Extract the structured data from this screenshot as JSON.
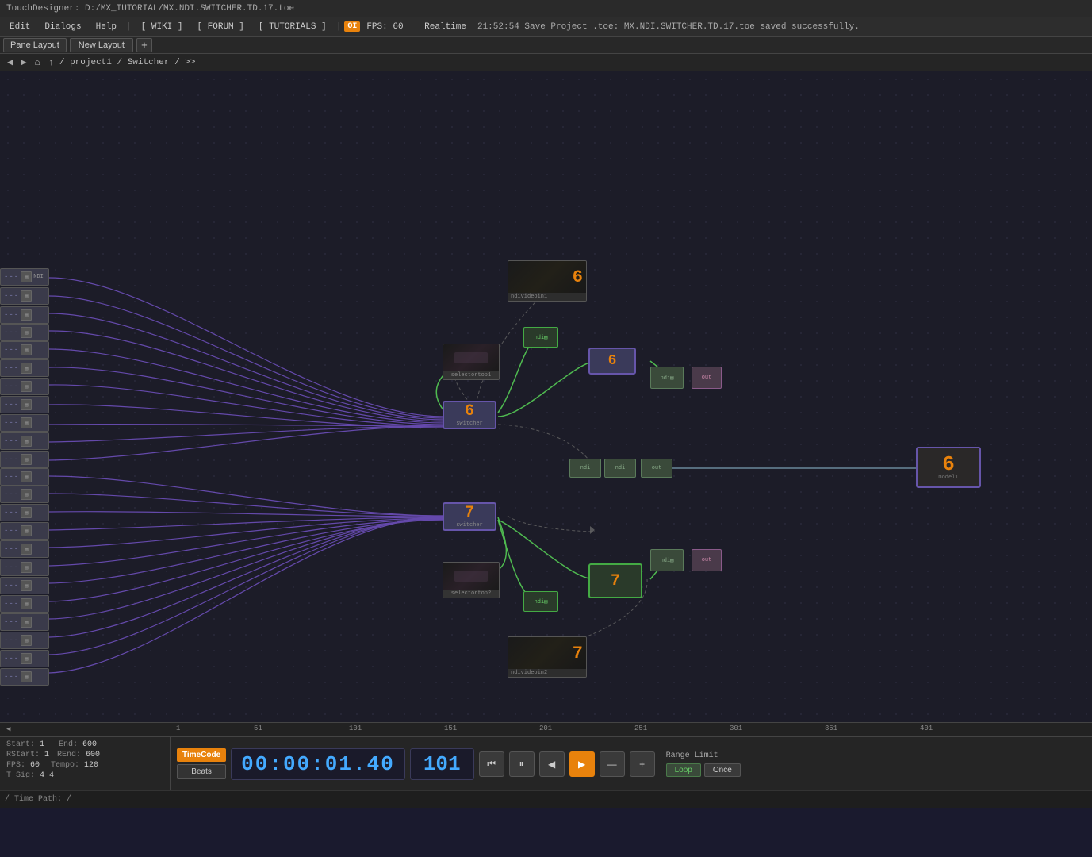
{
  "titlebar": {
    "text": "TouchDesigner: D:/MX_TUTORIAL/MX.NDI.SWITCHER.TD.17.toe"
  },
  "menubar": {
    "items": [
      "Edit",
      "Dialogs",
      "Help"
    ],
    "links": [
      "[ WIKI ]",
      "[ FORUM ]",
      "[ TUTORIALS ]"
    ],
    "badge": "OI",
    "fps_label": "FPS:",
    "fps_value": "60",
    "realtime": "Realtime",
    "status": "21:52:54 Save Project .toe: MX.NDI.SWITCHER.TD.17.toe saved successfully."
  },
  "panebar": {
    "pane_layout": "Pane Layout",
    "new_layout": "New Layout",
    "add": "+"
  },
  "breadcrumb": {
    "path": "/ project1 / Switcher / >>"
  },
  "nodes": {
    "center6_label": "6",
    "center6_sub": "switcher",
    "center7_label": "7",
    "center7_sub": "switcher",
    "video6_label": "6",
    "video7_label": "7",
    "output6_label": "6",
    "output7_label": "7",
    "orange6_label": "6",
    "orange7_label": "7"
  },
  "timeline": {
    "marks": [
      "1",
      "51",
      "101",
      "151",
      "201",
      "251",
      "301",
      "351",
      "401"
    ]
  },
  "transport": {
    "timecode_btn": "TimeCode",
    "beats_btn": "Beats",
    "time_display": "00:00:01.40",
    "frame_display": "101",
    "btn_start": "⏮",
    "btn_prev": "⏸",
    "btn_step_back": "◀",
    "btn_play": "▶",
    "btn_step_fwd": "—",
    "btn_end": "+",
    "range_label": "Range Limit",
    "loop_btn": "Loop",
    "once_btn": "Once"
  },
  "stats": {
    "start_label": "Start:",
    "start_val": "1",
    "end_label": "End:",
    "end_val": "600",
    "rt_label": "RStart:",
    "rt_val": "1",
    "rend_label": "REnd:",
    "rend_val": "600",
    "fps_label": "FPS:",
    "fps_val": "60",
    "tempo_label": "Tempo:",
    "tempo_val": "120",
    "tsig_label": "T Sig:",
    "tsig_val": "4   4"
  },
  "pathbar": {
    "text": "/ Time Path: /"
  }
}
